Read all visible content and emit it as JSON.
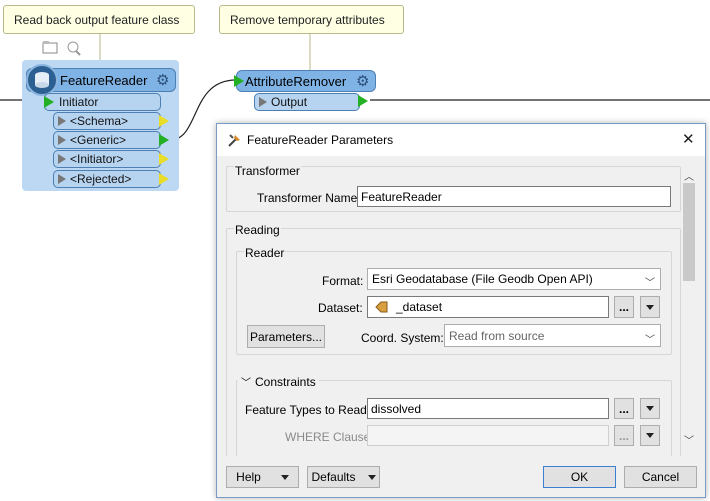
{
  "canvas": {
    "annotation1": "Read back output feature class",
    "annotation2": "Remove temporary attributes",
    "feature_reader": {
      "title": "FeatureReader",
      "input_port": "Initiator",
      "output_ports": [
        "<Schema>",
        "<Generic>",
        "<Initiator>",
        "<Rejected>"
      ]
    },
    "attribute_remover": {
      "title": "AttributeRemover",
      "output_port": "Output"
    }
  },
  "dialog": {
    "title": "FeatureReader Parameters",
    "transformer_section": "Transformer",
    "transformer_name_label": "Transformer Name:",
    "transformer_name_value": "FeatureReader",
    "reading_section": "Reading",
    "reader_group": "Reader",
    "format_label": "Format:",
    "format_value": "Esri Geodatabase (File Geodb Open API)",
    "dataset_label": "Dataset:",
    "dataset_value": "_dataset",
    "parameters_button": "Parameters...",
    "coord_label": "Coord. System:",
    "coord_value": "Read from source",
    "constraints_section": "Constraints",
    "feature_types_label": "Feature Types to Read:",
    "feature_types_value": "dissolved",
    "where_label": "WHERE Clause:",
    "where_value": "",
    "ellipsis": "...",
    "help_button": "Help",
    "defaults_button": "Defaults",
    "ok_button": "OK",
    "cancel_button": "Cancel",
    "close_glyph": "✕"
  },
  "colors": {
    "node_fill": "#7fb3e6",
    "node_background": "#bcd8f2",
    "annotation_fill": "#ffffe4",
    "port_output_green": "#24b024",
    "port_output_yellow": "#e9dd2a"
  }
}
